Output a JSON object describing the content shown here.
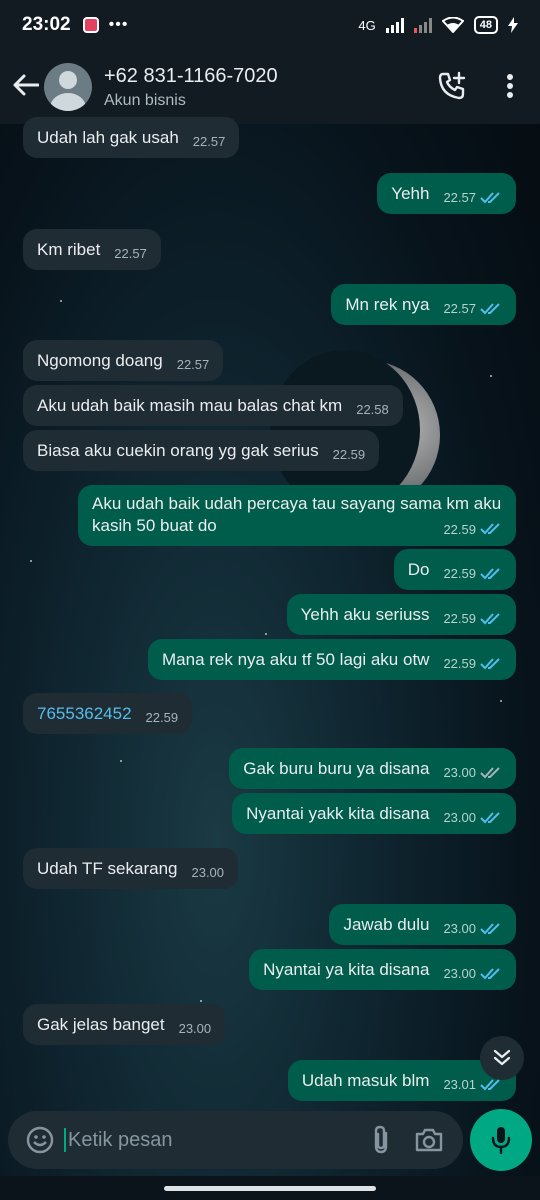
{
  "status_bar": {
    "time": "23:02",
    "network": "4G",
    "battery": "48",
    "icons": [
      "instagram-icon",
      "more-icon",
      "signal-icon",
      "wifi-icon",
      "battery-icon",
      "charging-icon"
    ]
  },
  "header": {
    "title": "+62 831-1166-7020",
    "subtitle": "Akun bisnis"
  },
  "messages": [
    {
      "dir": "in",
      "text": "Udah lah gak usah",
      "time": "22.57"
    },
    {
      "dir": "out",
      "text": "Yehh",
      "time": "22.57",
      "status": "read"
    },
    {
      "dir": "in",
      "text": "Km ribet",
      "time": "22.57"
    },
    {
      "dir": "out",
      "text": "Mn rek nya",
      "time": "22.57",
      "status": "read"
    },
    {
      "dir": "in",
      "text": "Ngomong doang",
      "time": "22.57"
    },
    {
      "dir": "in",
      "text": "Aku udah baik masih mau balas chat km",
      "time": "22.58"
    },
    {
      "dir": "in",
      "text": "Biasa aku cuekin orang yg gak serius",
      "time": "22.59"
    },
    {
      "dir": "out",
      "text": "Aku udah baik udah percaya tau sayang sama km aku",
      "text2": "kasih 50 buat do",
      "time": "22.59",
      "status": "read"
    },
    {
      "dir": "out",
      "text": "Do",
      "time": "22.59",
      "status": "read"
    },
    {
      "dir": "out",
      "text": "Yehh aku seriuss",
      "time": "22.59",
      "status": "read"
    },
    {
      "dir": "out",
      "text": "Mana rek nya aku tf 50 lagi aku otw",
      "time": "22.59",
      "status": "read"
    },
    {
      "dir": "in",
      "text": "7655362452",
      "time": "22.59",
      "link": true
    },
    {
      "dir": "out",
      "text": "Gak buru buru ya disana",
      "time": "23.00",
      "status": "delivered"
    },
    {
      "dir": "out",
      "text": "Nyantai yakk kita disana",
      "time": "23.00",
      "status": "read"
    },
    {
      "dir": "in",
      "text": "Udah TF sekarang",
      "time": "23.00"
    },
    {
      "dir": "out",
      "text": "Jawab dulu",
      "time": "23.00",
      "status": "read"
    },
    {
      "dir": "out",
      "text": "Nyantai ya kita disana",
      "time": "23.00",
      "status": "read"
    },
    {
      "dir": "in",
      "text": "Gak jelas banget",
      "time": "23.00"
    },
    {
      "dir": "out",
      "text": "Udah masuk blm",
      "time": "23.01",
      "status": "read"
    }
  ],
  "input": {
    "placeholder": "Ketik pesan"
  },
  "colors": {
    "incoming": "#202c33",
    "outgoing": "#005c4b",
    "read_tick": "#53bdeb",
    "delivered_tick": "#a4b4bb",
    "accent": "#00a884"
  }
}
